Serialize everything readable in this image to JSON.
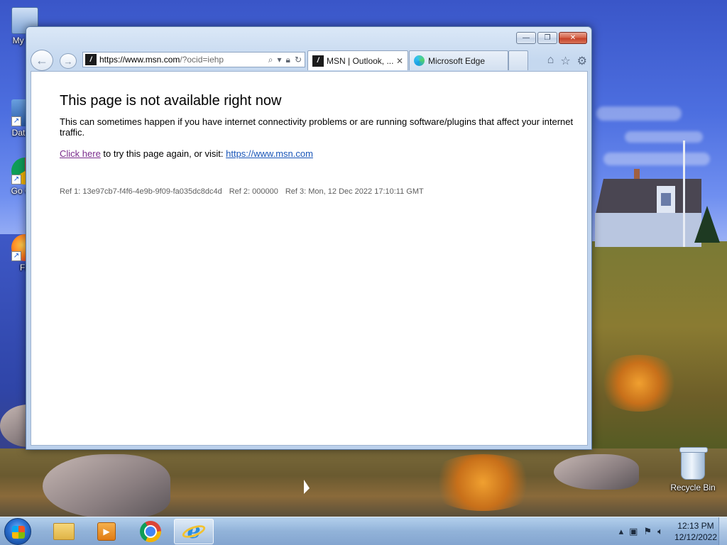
{
  "desktop": {
    "icons": [
      {
        "label": "My Co"
      },
      {
        "label": "DataW"
      },
      {
        "label": "Go Chr"
      },
      {
        "label": "Fir"
      }
    ],
    "recycle_bin": {
      "label": "Recycle Bin"
    }
  },
  "browser": {
    "address": {
      "host": "https://www.msn.com",
      "path": "/?ocid=iehp",
      "search_icon": "search-icon",
      "lock_icon": "lock-icon",
      "refresh_icon": "refresh-icon"
    },
    "tabs": [
      {
        "label": "MSN | Outlook, ...",
        "close": "✕",
        "active": true
      },
      {
        "label": "Microsoft Edge",
        "active": false
      }
    ],
    "window_controls": {
      "minimize": "—",
      "maximize": "❐",
      "close": "✕"
    },
    "page": {
      "title": "This page is not available right now",
      "description": "This can sometimes happen if you have internet connectivity problems or are running software/plugins that affect your internet traffic.",
      "retry_link": "Click here",
      "retry_text": " to try this page again, or visit: ",
      "msn_link": "https://www.msn.com",
      "ref1": "Ref 1: 13e97cb7-f4f6-4e9b-9f09-fa035dc8dc4d",
      "ref2": "Ref 2: 000000",
      "ref3": "Ref 3: Mon, 12 Dec 2022 17:10:11 GMT"
    }
  },
  "taskbar": {
    "clock": {
      "time": "12:13 PM",
      "date": "12/12/2022"
    }
  },
  "colors": {
    "link_visited": "#7a2c8c",
    "link": "#1a56b8",
    "close_button": "#c5432a"
  }
}
